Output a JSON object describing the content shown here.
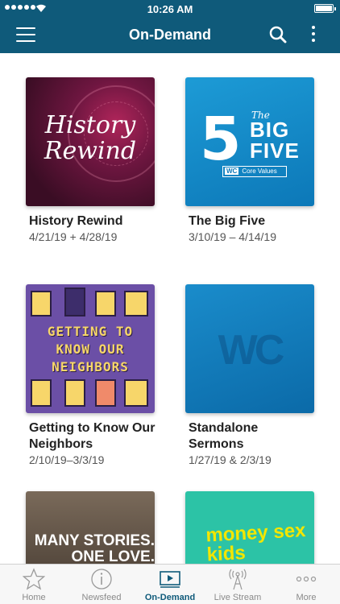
{
  "status_bar": {
    "time": "10:26 AM"
  },
  "header": {
    "title": "On-Demand"
  },
  "series": [
    {
      "title": "History Rewind",
      "dates": "4/21/19 + 4/28/19",
      "art_text": "History Rewind"
    },
    {
      "title": "The Big Five",
      "dates": "3/10/19 – 4/14/19",
      "art_the": "The",
      "art_big": "BIG",
      "art_five": "FIVE",
      "art_badge_wc": "WC",
      "art_badge_text": "Core Values"
    },
    {
      "title": "Getting to Know Our Neighbors",
      "dates": "2/10/19–3/3/19",
      "art_words": [
        "GETTING TO",
        "KNOW OUR",
        "NEIGHBORS"
      ]
    },
    {
      "title": "Standalone Sermons",
      "dates": "1/27/19 & 2/3/19",
      "art_logo": "WC"
    },
    {
      "title": "",
      "dates": "",
      "art_text": "MANY STORIES. ONE LOVE."
    },
    {
      "title": "",
      "dates": "",
      "art_text": "money sex kids"
    }
  ],
  "tabs": [
    {
      "label": "Home",
      "icon": "star-icon",
      "active": false
    },
    {
      "label": "Newsfeed",
      "icon": "info-icon",
      "active": false
    },
    {
      "label": "On-Demand",
      "icon": "play-screen-icon",
      "active": true
    },
    {
      "label": "Live Stream",
      "icon": "broadcast-tower-icon",
      "active": false
    },
    {
      "label": "More",
      "icon": "more-dots-icon",
      "active": false
    }
  ],
  "colors": {
    "header_bg": "#0f5a7a",
    "active_tab": "#0f5a7a",
    "inactive_tab": "#8a8a8a"
  }
}
